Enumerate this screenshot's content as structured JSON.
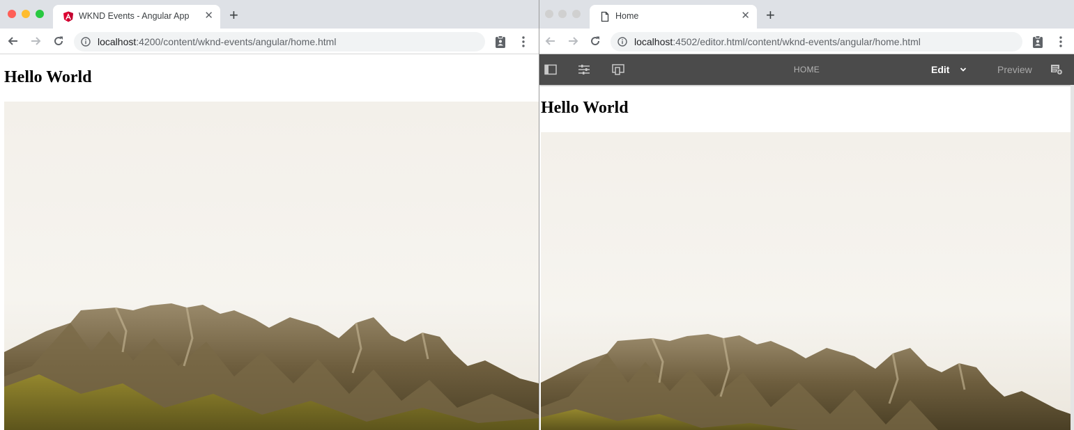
{
  "left_window": {
    "tab": {
      "favicon": "angular-icon",
      "title": "WKND Events - Angular App"
    },
    "new_tab_icon": "plus-icon",
    "toolbar": {
      "url_host": "localhost",
      "url_rest": ":4200/content/wknd-events/angular/home.html"
    },
    "page": {
      "heading": "Hello World"
    }
  },
  "right_window": {
    "tab": {
      "favicon": "document-icon",
      "title": "Home"
    },
    "new_tab_icon": "plus-icon",
    "toolbar": {
      "url_host": "localhost",
      "url_rest": ":4502/editor.html/content/wknd-events/angular/home.html"
    },
    "editor_bar": {
      "title": "HOME",
      "mode_label": "Edit",
      "preview_label": "Preview"
    },
    "page": {
      "heading": "Hello World"
    }
  },
  "colors": {
    "traffic_close": "#ff5f57",
    "traffic_minimize": "#febc2e",
    "traffic_zoom": "#28c840",
    "angular_red": "#dd0031",
    "editor_bar": "#4b4b4b"
  }
}
